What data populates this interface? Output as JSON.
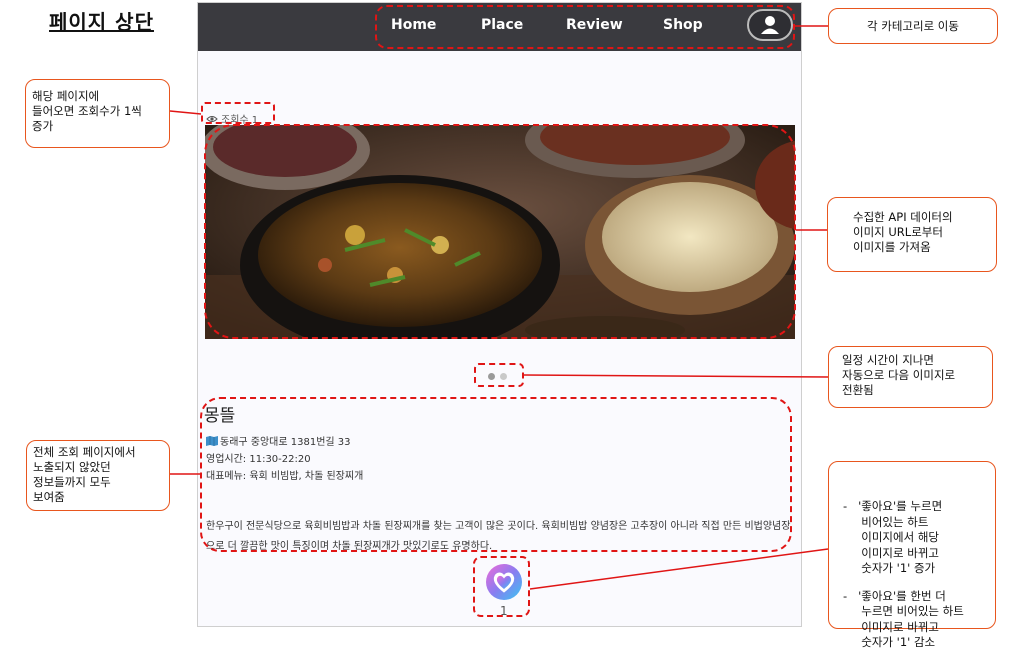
{
  "page_title": "페이지 상단",
  "nav": {
    "items": [
      "Home",
      "Place",
      "Review",
      "Shop"
    ],
    "profile_icon": "user-icon"
  },
  "views": {
    "icon": "eye-icon",
    "label": "조회수 1"
  },
  "carousel": {
    "total_slides": 2,
    "active_index": 0
  },
  "restaurant": {
    "name": "몽뜰",
    "address_icon": "map-icon",
    "address": "동래구 중앙대로 1381번길 33",
    "hours": "영업시간:   11:30-22:20",
    "menu": "대표메뉴:   육회 비빔밥, 차돌 된장찌개",
    "description": "한우구이 전문식당으로 육회비빔밥과 차돌 된장찌개를 찾는 고객이 많은 곳이다. 육회비빔밥 양념장은 고추장이 아니라 직접 만든 비법양념장으로 더 깔끔한 맛이 특징이며 차돌 된장찌개가 맛있기로도 유명하다."
  },
  "like": {
    "icon": "heart-icon",
    "count": "1"
  },
  "callouts": {
    "nav": "각 카테고리로 이동",
    "views": [
      "해당 페이지에",
      "들어오면 조회수가 1씩",
      "증가"
    ],
    "image": [
      "수집한 API 데이터의",
      "이미지 URL로부터",
      "이미지를 가져옴"
    ],
    "carousel": [
      "일정 시간이 지나면",
      "자동으로 다음 이미지로",
      "전환됨"
    ],
    "details": [
      "전체 조회 페이지에서",
      "노출되지 않았던",
      "정보들까지 모두",
      "보여줌"
    ],
    "like": [
      "-   '좋아요'를 누르면",
      "     비어있는 하트",
      "     이미지에서 해당",
      "     이미지로 바뀌고",
      "     숫자가 '1' 증가",
      "",
      "-   '좋아요'를 한번 더",
      "     누르면 비어있는 하트",
      "     이미지로 바뀌고",
      "     숫자가 '1' 감소"
    ]
  },
  "colors": {
    "navbar": "#3a3a3f",
    "highlight": "#e01515",
    "callout_border": "#e8561e"
  }
}
